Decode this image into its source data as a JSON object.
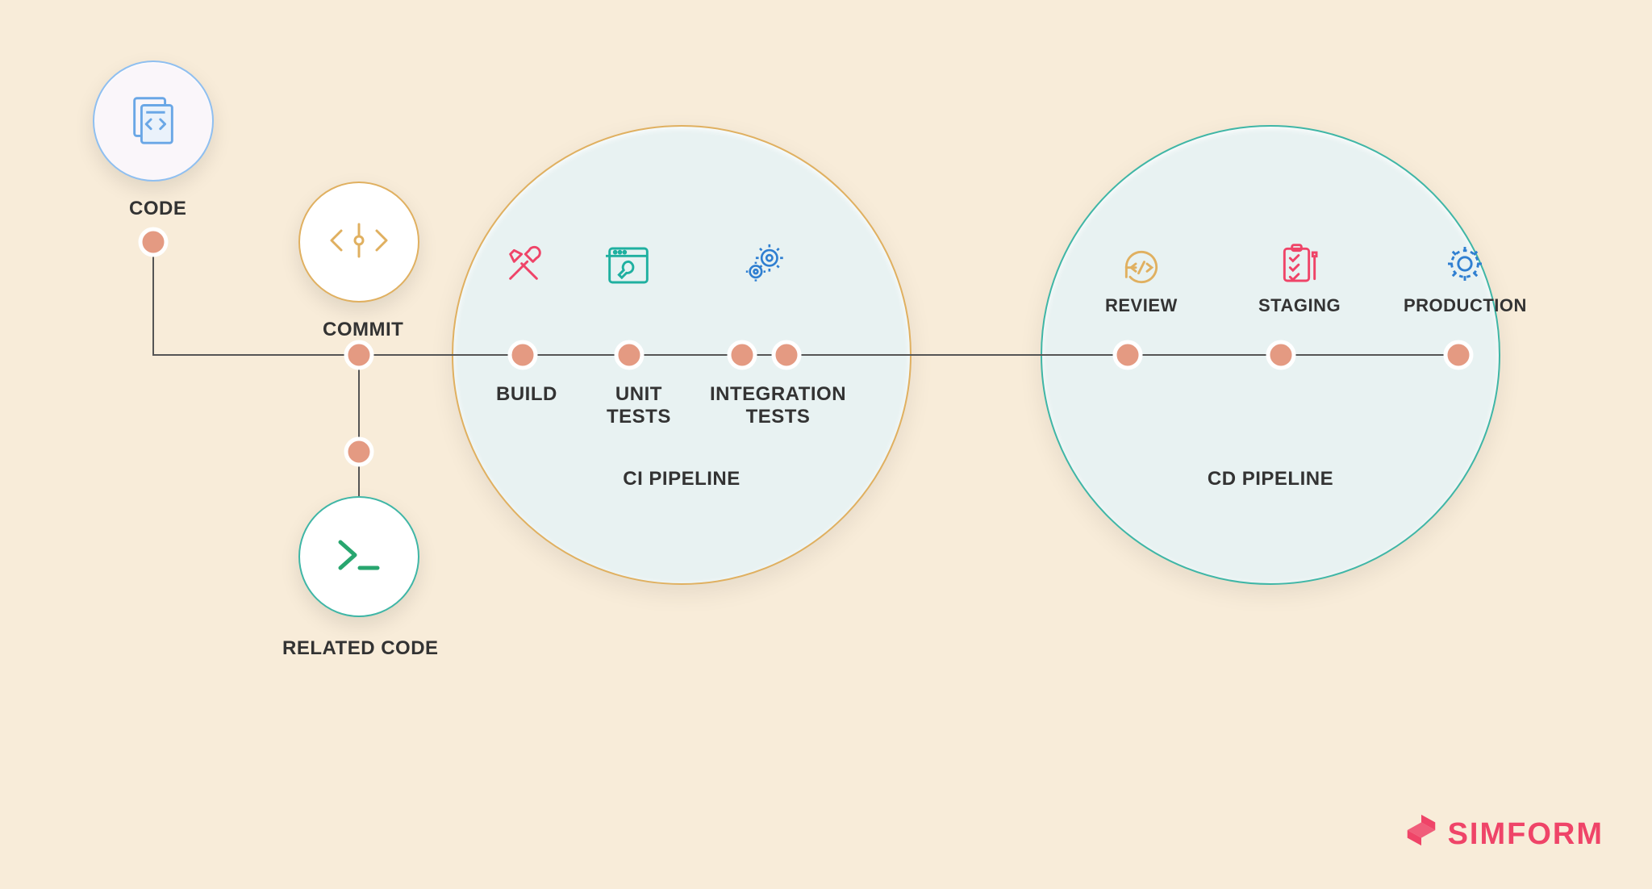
{
  "nodes": {
    "code": {
      "label": "CODE"
    },
    "commit": {
      "label": "COMMIT"
    },
    "related": {
      "label": "RELATED CODE"
    }
  },
  "ci": {
    "title": "CI PIPELINE",
    "stages": {
      "build": {
        "label": "BUILD"
      },
      "unit": {
        "label": "UNIT\nTESTS"
      },
      "integration": {
        "label": "INTEGRATION\nTESTS"
      }
    }
  },
  "cd": {
    "title": "CD PIPELINE",
    "stages": {
      "review": {
        "label": "REVIEW"
      },
      "staging": {
        "label": "STAGING"
      },
      "production": {
        "label": "PRODUCTION"
      }
    }
  },
  "brand": {
    "name": "SIMFORM"
  },
  "colors": {
    "bg": "#f8ecd9",
    "dot": "#e49a82",
    "ciRing": "#e0b060",
    "cdRing": "#3fb6a6",
    "brand": "#ef4468"
  }
}
